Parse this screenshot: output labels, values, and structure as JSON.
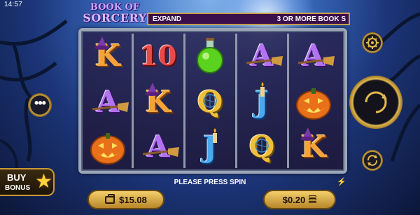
{
  "status_bar": {
    "time": "14:57"
  },
  "game": {
    "logo_line1": "BOOK OF",
    "logo_line2": "SORCERY"
  },
  "banner": {
    "left_text": "EXPAND",
    "right_text": "3 OR MORE BOOK S"
  },
  "reels": [
    [
      "K",
      "A",
      "pumpkin"
    ],
    [
      "10",
      "K",
      "A"
    ],
    [
      "potion",
      "Q",
      "J"
    ],
    [
      "A",
      "J",
      "Q"
    ],
    [
      "A",
      "pumpkin",
      "K"
    ]
  ],
  "symbols": {
    "K": "K",
    "10": "10",
    "A": "A",
    "Q": "Q",
    "J": "J"
  },
  "buy_bonus": {
    "line1": "BUY",
    "line2": "BONUS",
    "icon": "star-icon"
  },
  "message": "PLEASE PRESS SPIN",
  "balance": {
    "icon": "wallet-icon",
    "amount": "$15.08"
  },
  "bet": {
    "amount": "$0.20",
    "icon": "coin-stack-icon"
  },
  "controls": {
    "menu_icon": "more-dots-icon",
    "settings_icon": "gear-icon",
    "spin_icon": "spin-arrow-icon",
    "autoplay_icon": "autoplay-icon"
  },
  "colors": {
    "gold": "#e0b850",
    "banner_bg": "#3b0e4c",
    "frame": "#9aa6b8"
  }
}
